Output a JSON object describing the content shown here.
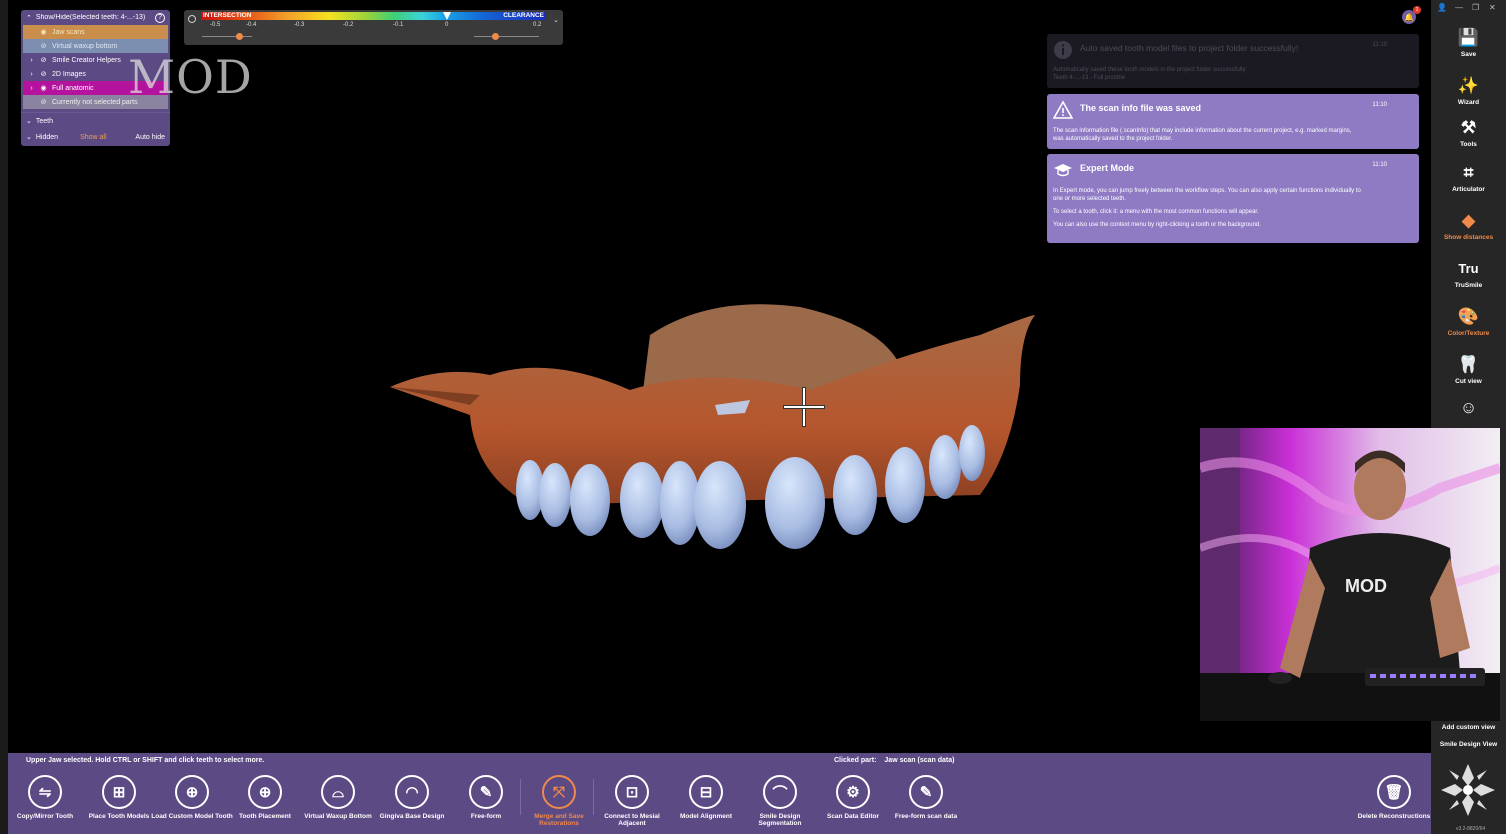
{
  "showhide": {
    "title": "Show/Hide(Selected teeth: 4-...-13)",
    "help": "?",
    "rows": [
      {
        "label": "Jaw scans"
      },
      {
        "label": "Virtual waxup bottom"
      },
      {
        "label": "Smile Creator Helpers"
      },
      {
        "label": "2D Images"
      },
      {
        "label": "Full anatomic"
      },
      {
        "label": "Currently not selected parts"
      }
    ],
    "teeth_label": "Teeth",
    "hidden_label": "Hidden",
    "show_all": "Show all",
    "auto_hide": "Auto hide"
  },
  "watermark": "MOD",
  "scale": {
    "left_label": "INTERSECTION",
    "right_label": "CLEARANCE",
    "ticks": [
      "-0.5",
      "-0.4",
      "-0.3",
      "-0.2",
      "-0.1",
      "0",
      "0.2"
    ],
    "colors": {
      "intersection": "#c81010",
      "clearance": "#1a2bb8",
      "knob": "#f08a4b"
    }
  },
  "notifications": [
    {
      "title": "Auto saved tooth model files to project folder successfully!",
      "time": "11:10",
      "body": [
        "Automatically saved these tooth models in the project folder successfully:",
        "Teeth 4-...-13 - Full prosthe"
      ]
    },
    {
      "title": "The scan info file was saved",
      "time": "11:10",
      "body": [
        "The scan information file (.scanInfo) that may include information about the current project, e.g. marked margins,",
        "was automatically saved to the project folder."
      ]
    },
    {
      "title": "Expert Mode",
      "time": "11:10",
      "body": [
        "In Expert mode, you can jump freely between the workflow steps. You can also apply certain functions individually to",
        "one or more selected teeth.",
        "To select a tooth, click it: a menu with the most common functions will appear.",
        "You can also use the context menu by right-clicking a tooth or the background."
      ]
    }
  ],
  "bell_count": "1",
  "window_controls": [
    "person-icon",
    "minimize-icon",
    "restore-icon",
    "close-icon"
  ],
  "right_toolbar": [
    {
      "label": "Save",
      "icon": "save-icon"
    },
    {
      "label": "Wizard",
      "icon": "wand-icon"
    },
    {
      "label": "Tools",
      "icon": "tools-icon"
    },
    {
      "label": "Articulator",
      "icon": "articulator-icon"
    },
    {
      "label": "Show distances",
      "icon": "distances-icon"
    },
    {
      "label": "TruSmile",
      "icon": "trusmile-icon",
      "glyph": "Tru"
    },
    {
      "label": "Color/Texture",
      "icon": "palette-icon"
    },
    {
      "label": "Cut view",
      "icon": "cutview-icon"
    }
  ],
  "add_custom_view": "Add custom view",
  "smile_design_view": "Smile Design View",
  "version": "v3.2-8820/64",
  "video": {
    "shirt_text": "MOD"
  },
  "bottom": {
    "status_left": "Upper Jaw selected. Hold CTRL or SHIFT and click teeth to select more.",
    "clicked_part_label": "Clicked part:",
    "clicked_part_value": "Jaw scan (scan data)",
    "tools": [
      {
        "label": "Copy/Mirror Tooth",
        "icon": "copy-mirror-icon"
      },
      {
        "label": "Place Tooth Models",
        "icon": "place-tooth-icon"
      },
      {
        "label": "Load Custom Model Tooth",
        "icon": "load-model-icon"
      },
      {
        "label": "Tooth Placement",
        "icon": "tooth-placement-icon"
      },
      {
        "label": "Virtual Waxup Bottom",
        "icon": "waxup-icon"
      },
      {
        "label": "Gingiva Base Design",
        "icon": "gingiva-icon"
      },
      {
        "label": "Free-form",
        "icon": "freeform-icon"
      },
      {
        "label": "Merge and Save Restorations",
        "icon": "merge-icon",
        "active": true
      },
      {
        "label": "Connect to Mesial Adjacent",
        "icon": "connect-icon"
      },
      {
        "label": "Model Alignment",
        "icon": "alignment-icon"
      },
      {
        "label": "Smile Design Segmentation",
        "icon": "segmentation-icon"
      },
      {
        "label": "Scan Data Editor",
        "icon": "scan-editor-icon"
      },
      {
        "label": "Free-form scan data",
        "icon": "freeform-scan-icon"
      },
      {
        "label": "Delete Reconstructions",
        "icon": "trash-icon"
      }
    ]
  }
}
